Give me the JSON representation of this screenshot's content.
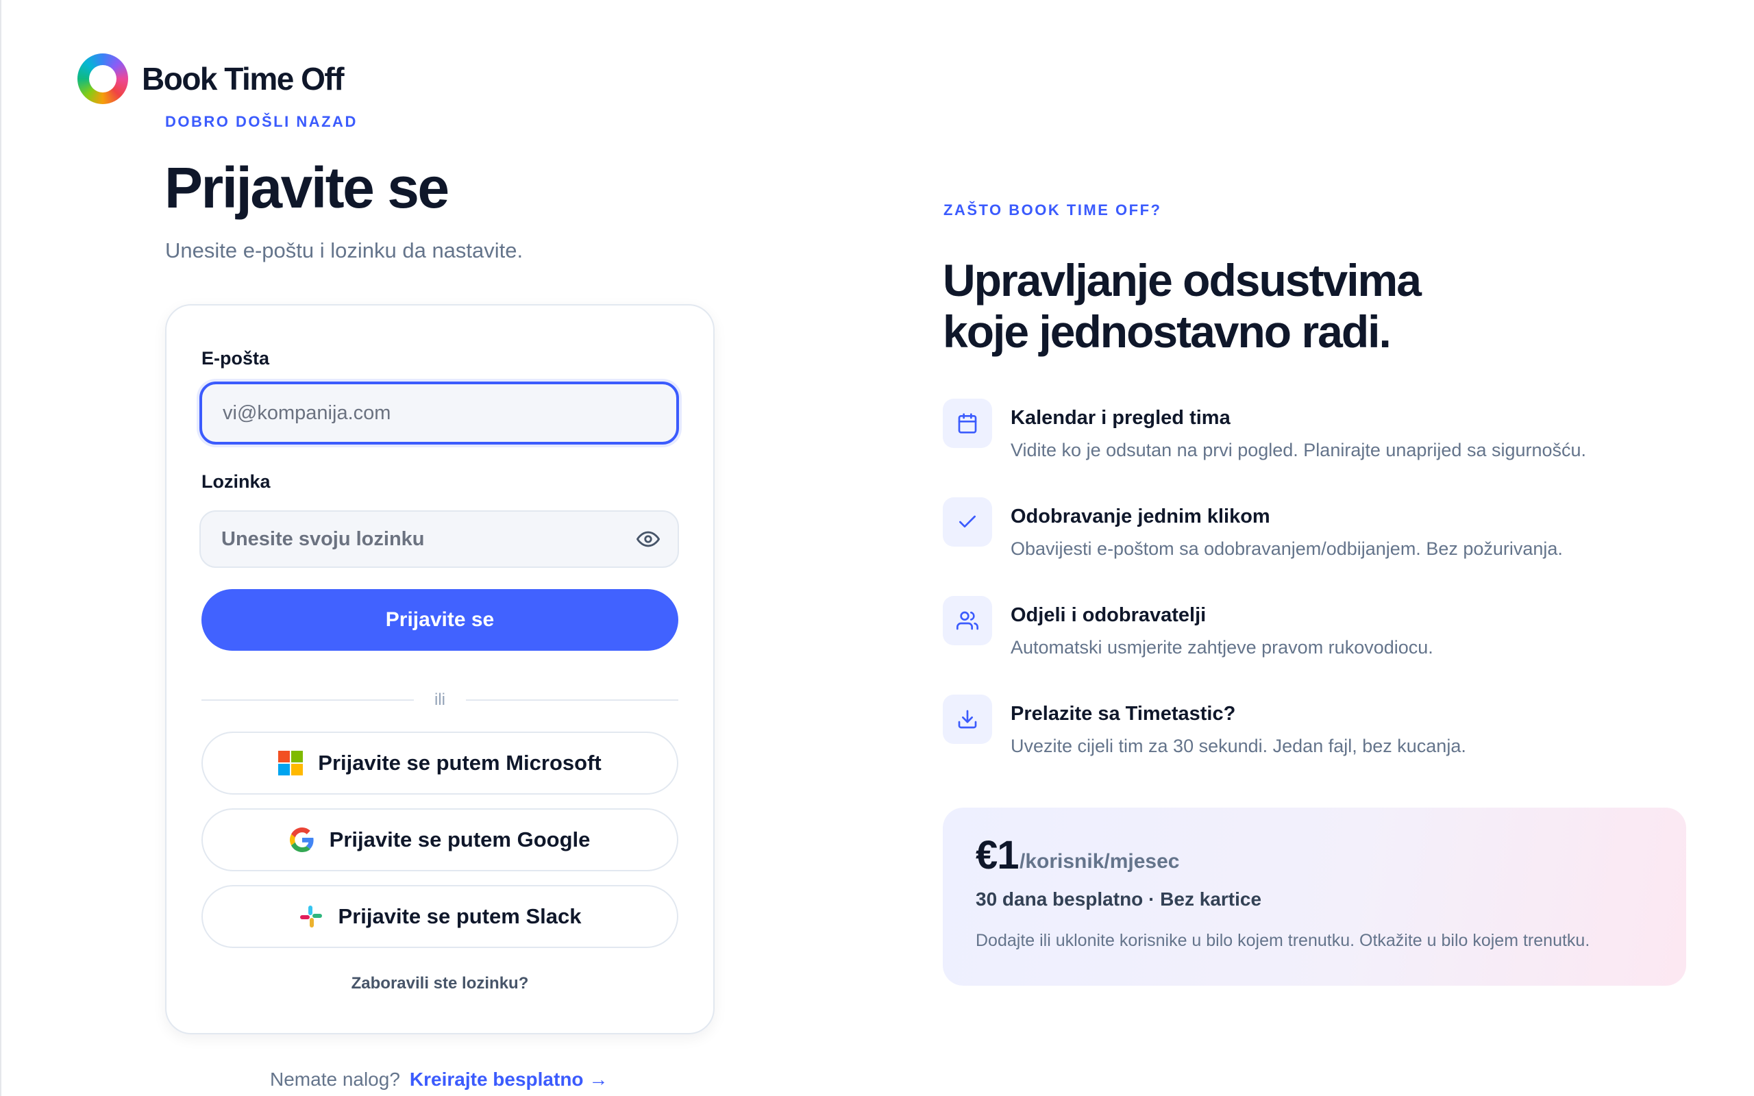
{
  "brand": {
    "name": "Book Time Off"
  },
  "login": {
    "eyebrow": "DOBRO DOŠLI NAZAD",
    "title": "Prijavite se",
    "subtitle": "Unesite e-poštu i lozinku da nastavite.",
    "email_label": "E-pošta",
    "email_placeholder": "vi@kompanija.com",
    "email_value": "",
    "password_label": "Lozinka",
    "password_placeholder": "Unesite svoju lozinku",
    "password_value": "",
    "submit_label": "Prijavite se",
    "divider_text": "ili",
    "microsoft_label": "Prijavite se putem Microsoft",
    "google_label": "Prijavite se putem Google",
    "slack_label": "Prijavite se putem Slack",
    "forgot_label": "Zaboravili ste lozinku?",
    "no_account_text": "Nemate nalog?",
    "create_label": "Kreirajte besplatno →"
  },
  "why": {
    "eyebrow": "ZAŠTO BOOK TIME OFF?",
    "title_line1": "Upravljanje odsustvima",
    "title_line2": "koje jednostavno radi.",
    "features": [
      {
        "icon": "calendar-icon",
        "title": "Kalendar i pregled tima",
        "desc": "Vidite ko je odsutan na prvi pogled. Planirajte unaprijed sa sigurnošću."
      },
      {
        "icon": "check-icon",
        "title": "Odobravanje jednim klikom",
        "desc": "Obavijesti e-poštom sa odobravanjem/odbijanjem. Bez požurivanja."
      },
      {
        "icon": "users-icon",
        "title": "Odjeli i odobravatelji",
        "desc": "Automatski usmjerite zahtjeve pravom rukovodiocu."
      },
      {
        "icon": "download-icon",
        "title": "Prelazite sa Timetastic?",
        "desc": "Uvezite cijeli tim za 30 sekundi. Jedan fajl, bez kucanja."
      }
    ]
  },
  "pricing": {
    "amount": "€1",
    "unit": "/korisnik/mjesec",
    "trial": "30 dana besplatno · Bez kartice",
    "note": "Dodajte ili uklonite korisnike u bilo kojem trenutku. Otkažite u bilo kojem trenutku."
  },
  "colors": {
    "accent": "#4162ff",
    "eyebrow": "#3b5bfd",
    "text": "#0f172a",
    "muted": "#64748b"
  }
}
